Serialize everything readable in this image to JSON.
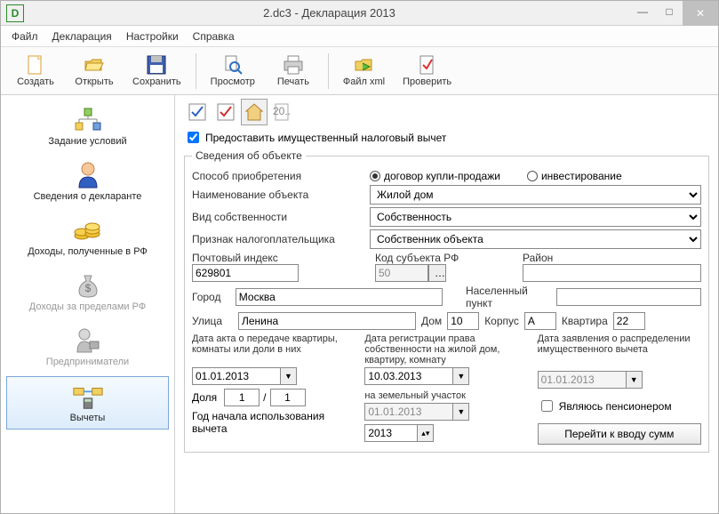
{
  "window": {
    "title": "2.dc3 - Декларация 2013",
    "logo": "D"
  },
  "menubar": {
    "file": "Файл",
    "decl": "Декларация",
    "settings": "Настройки",
    "help": "Справка"
  },
  "toolbar": {
    "create": "Создать",
    "open": "Открыть",
    "save": "Сохранить",
    "preview": "Просмотр",
    "print": "Печать",
    "xml": "Файл xml",
    "check": "Проверить"
  },
  "sidebar": {
    "conditions": "Задание условий",
    "declarant": "Сведения о декларанте",
    "income_rf": "Доходы, полученные в РФ",
    "income_abroad": "Доходы за пределами РФ",
    "entrepreneurs": "Предприниматели",
    "deductions": "Вычеты"
  },
  "main": {
    "provide_deduction": "Предоставить имущественный налоговый вычет",
    "legend": "Сведения об объекте",
    "acquisition": {
      "label": "Способ приобретения",
      "opt1": "договор купли-продажи",
      "opt2": "инвестирование"
    },
    "object_name": {
      "label": "Наименование объекта",
      "value": "Жилой дом"
    },
    "ownership_type": {
      "label": "Вид собственности",
      "value": "Собственность"
    },
    "taxpayer_sign": {
      "label": "Признак налогоплательщика",
      "value": "Собственник объекта"
    },
    "postal": {
      "label": "Почтовый индекс",
      "value": "629801"
    },
    "region_code": {
      "label": "Код субъекта РФ",
      "value": "50"
    },
    "district": {
      "label": "Район",
      "value": ""
    },
    "city": {
      "label": "Город",
      "value": "Москва"
    },
    "settlement": {
      "label": "Населенный пункт",
      "value": ""
    },
    "street": {
      "label": "Улица",
      "value": "Ленина"
    },
    "house": {
      "label": "Дом",
      "value": "10"
    },
    "building": {
      "label": "Корпус",
      "value": "А"
    },
    "flat": {
      "label": "Квартира",
      "value": "22"
    },
    "date_act": {
      "label": "Дата акта о передаче квартиры, комнаты или доли в них",
      "value": "01.01.2013"
    },
    "date_reg": {
      "label": "Дата регистрации права собственности на жилой дом, квартиру, комнату",
      "value": "10.03.2013"
    },
    "date_land": {
      "label": "на земельный участок",
      "value": "01.01.2013"
    },
    "date_app": {
      "label": "Дата заявления о распределении имущественного вычета",
      "value": "01.01.2013"
    },
    "share": {
      "label": "Доля",
      "num": "1",
      "den": "1",
      "sep": "/"
    },
    "year_start": {
      "label": "Год начала использования вычета",
      "value": "2013"
    },
    "pensioner": "Являюсь пенсионером",
    "goto_sums": "Перейти к вводу сумм"
  }
}
